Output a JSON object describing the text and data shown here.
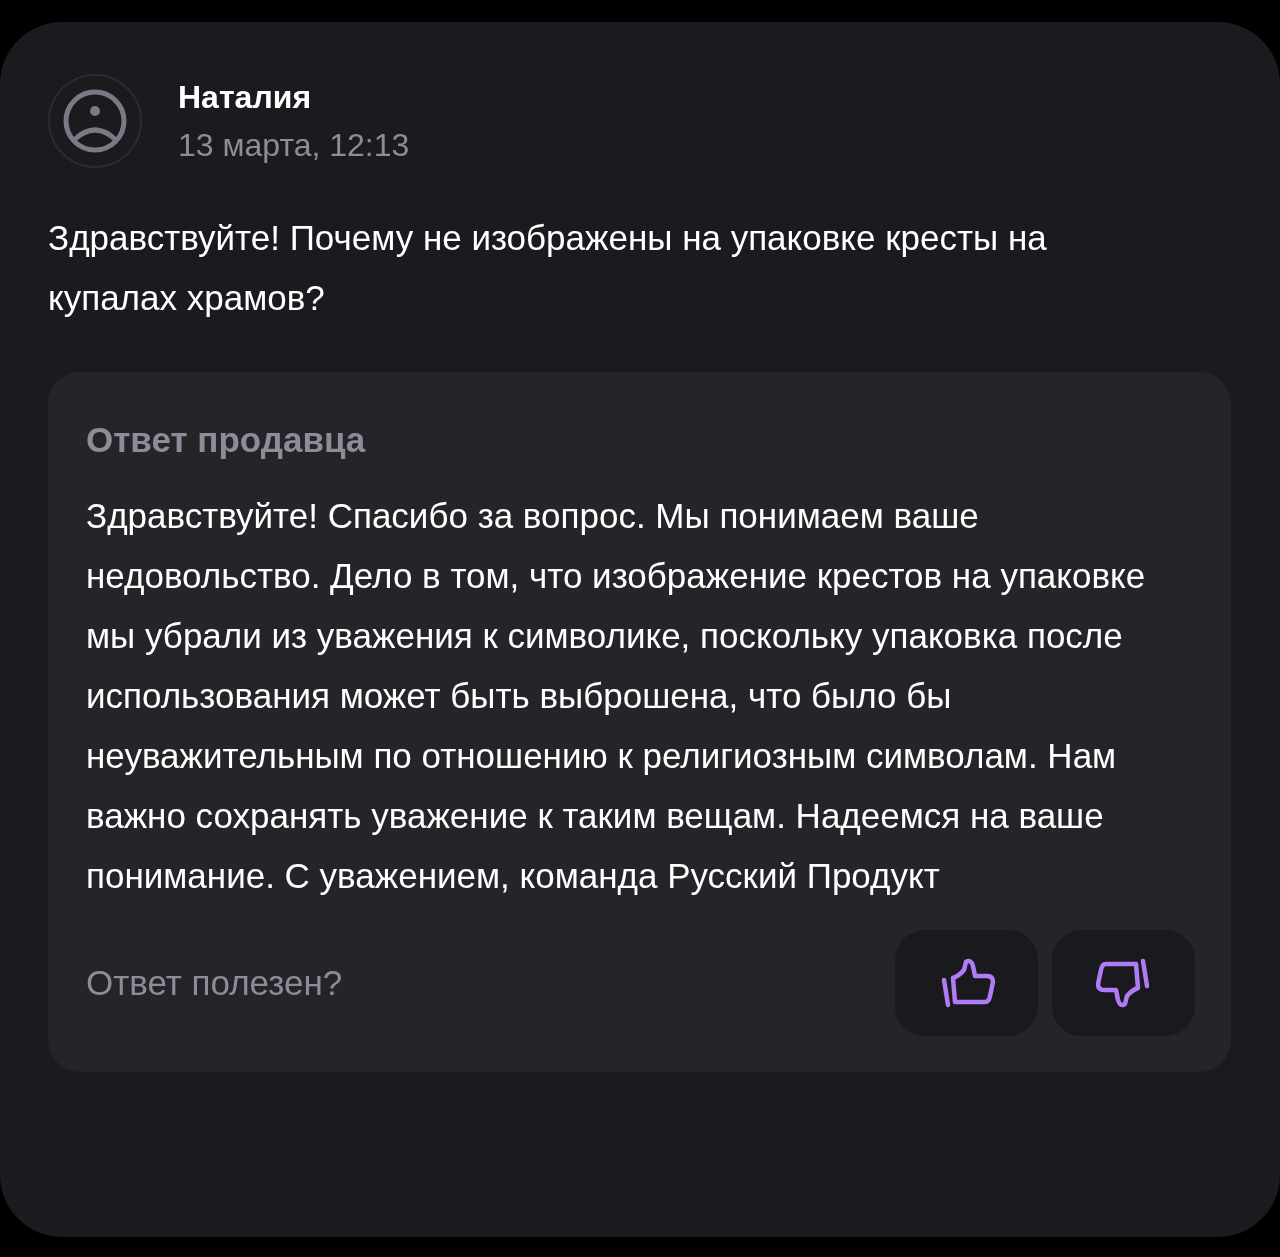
{
  "question": {
    "author": "Наталия",
    "date": "13 марта, 12:13",
    "text": "Здравствуйте! Почему не изображены на упаковке кресты на купалах храмов?"
  },
  "answer": {
    "title": "Ответ продавца",
    "text": "Здравствуйте! Спасибо за вопрос. Мы понимаем ваше недовольство. Дело в том, что изображение крестов на упаковке мы убрали из уважения к символике, поскольку упаковка после использования может быть выброшена, что было бы неуважительным по отношению к религиозным символам. Нам важно сохранять уважение к таким вещам. Надеемся на ваше понимание. С уважением, команда Русский Продукт",
    "helpful_prompt": "Ответ полезен?"
  },
  "votes": [
    {
      "kind": "like",
      "selected": false
    },
    {
      "kind": "dislike",
      "selected": false
    }
  ]
}
